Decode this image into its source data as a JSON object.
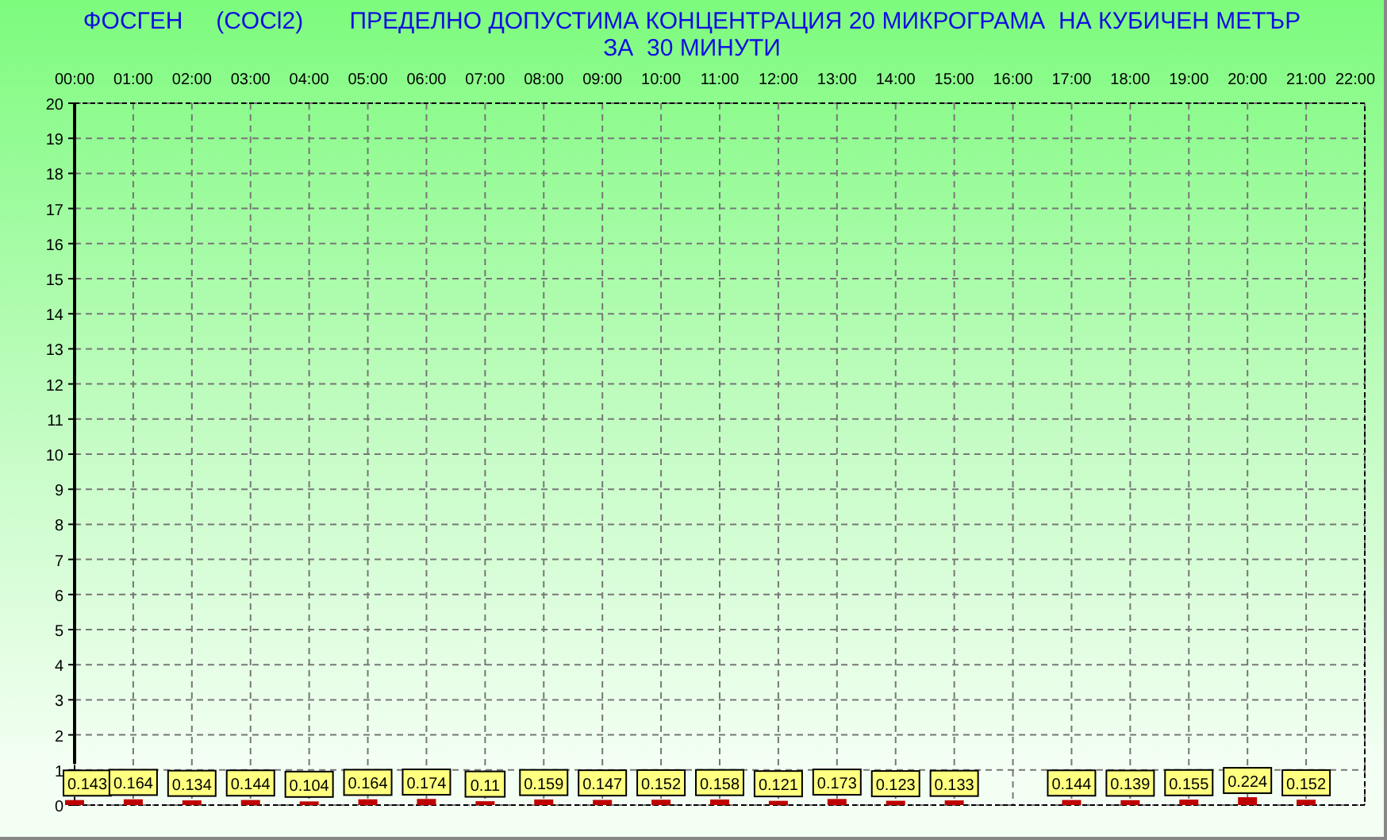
{
  "header": [
    "ФОСГЕН     (COCl2)       ПРЕДЕЛНО ДОПУСТИМА КОНЦЕНТРАЦИЯ 20 МИКРОГРАМА  НА КУБИЧЕН МЕТЪР",
    "ЗА  30 МИНУТИ"
  ],
  "chart_data": {
    "type": "bar",
    "categories": [
      "00:00",
      "01:00",
      "02:00",
      "03:00",
      "04:00",
      "05:00",
      "06:00",
      "07:00",
      "08:00",
      "09:00",
      "10:00",
      "11:00",
      "12:00",
      "13:00",
      "14:00",
      "15:00",
      "16:00",
      "17:00",
      "18:00",
      "19:00",
      "20:00",
      "21:00",
      "22:00"
    ],
    "series": [
      {
        "color": "#c00000",
        "values": [
          0.143,
          0.164,
          0.134,
          0.144,
          0.104,
          0.164,
          0.174,
          0.11,
          0.159,
          0.147,
          0.152,
          0.158,
          0.121,
          0.173,
          0.123,
          0.133,
          null,
          0.144,
          0.139,
          0.155,
          0.224,
          0.152,
          null
        ]
      }
    ],
    "ylim": [
      0,
      20
    ],
    "yticks": [
      0,
      1,
      2,
      3,
      4,
      5,
      6,
      7,
      8,
      9,
      10,
      11,
      12,
      13,
      14,
      15,
      16,
      17,
      18,
      19,
      20
    ],
    "grid": true,
    "data_labels": true
  }
}
